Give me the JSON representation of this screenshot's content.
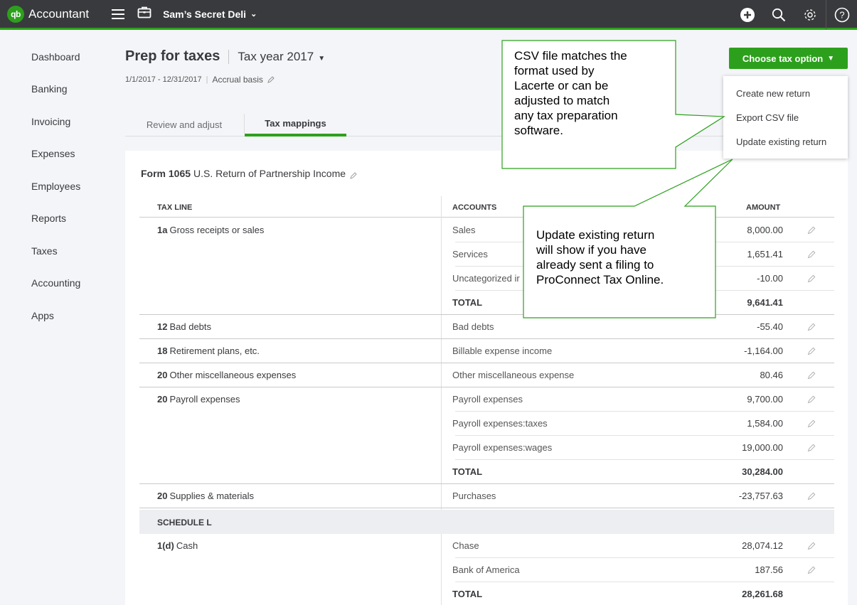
{
  "topbar": {
    "logo_badge": "qb",
    "app_name": "Accountant",
    "company_name": "Sam’s Secret Deli",
    "icons": [
      "menu-icon",
      "briefcase-icon",
      "add-icon",
      "search-icon",
      "gear-icon",
      "help-icon"
    ],
    "accent_color": "#2ca01c"
  },
  "sidebar": {
    "items": [
      {
        "label": "Dashboard"
      },
      {
        "label": "Banking"
      },
      {
        "label": "Invoicing"
      },
      {
        "label": "Expenses"
      },
      {
        "label": "Employees"
      },
      {
        "label": "Reports"
      },
      {
        "label": "Taxes"
      },
      {
        "label": "Accounting"
      },
      {
        "label": "Apps"
      }
    ]
  },
  "header": {
    "title": "Prep for taxes",
    "tax_year": "Tax year 2017",
    "date_range": "1/1/2017 - 12/31/2017",
    "basis": "Accrual basis"
  },
  "tabs": {
    "review": "Review and adjust",
    "mappings": "Tax mappings"
  },
  "choose_tax": {
    "button_label": "Choose tax option",
    "options": [
      "Create new return",
      "Export CSV file",
      "Update existing return"
    ]
  },
  "form": {
    "code": "Form 1065",
    "name": "U.S. Return of Partnership Income"
  },
  "table": {
    "headers": {
      "tax_line": "TAX LINE",
      "accounts": "ACCOUNTS",
      "amount": "AMOUNT"
    },
    "rows": [
      {
        "line_num": "1a",
        "line_desc": "Gross receipts or sales",
        "account": "Sales",
        "amount": "8,000.00"
      },
      {
        "line_num": "",
        "line_desc": "",
        "account": "Services",
        "amount": "1,651.41"
      },
      {
        "line_num": "",
        "line_desc": "",
        "account": "Uncategorized ir",
        "amount": "-10.00"
      },
      {
        "line_num": "",
        "line_desc": "",
        "account": "TOTAL",
        "amount": "9,641.41"
      },
      {
        "line_num": "12",
        "line_desc": "Bad debts",
        "account": "Bad debts",
        "amount": "-55.40"
      },
      {
        "line_num": "18",
        "line_desc": "Retirement plans, etc.",
        "account": "Billable expense income",
        "amount": "-1,164.00"
      },
      {
        "line_num": "20",
        "line_desc": "Other miscellaneous expenses",
        "account": "Other miscellaneous expense",
        "amount": "80.46"
      },
      {
        "line_num": "20",
        "line_desc": "Payroll expenses",
        "account": "Payroll expenses",
        "amount": "9,700.00"
      },
      {
        "line_num": "",
        "line_desc": "",
        "account": "Payroll expenses:taxes",
        "amount": "1,584.00"
      },
      {
        "line_num": "",
        "line_desc": "",
        "account": "Payroll expenses:wages",
        "amount": "19,000.00"
      },
      {
        "line_num": "",
        "line_desc": "",
        "account": "TOTAL",
        "amount": "30,284.00"
      },
      {
        "line_num": "20",
        "line_desc": "Supplies & materials",
        "account": "Purchases",
        "amount": "-23,757.63"
      }
    ],
    "schedule_label": "SCHEDULE L",
    "schedule_rows": [
      {
        "line_num": "1(d)",
        "line_desc": "Cash",
        "account": "Chase",
        "amount": "28,074.12"
      },
      {
        "line_num": "",
        "line_desc": "",
        "account": "Bank of America",
        "amount": "187.56"
      },
      {
        "line_num": "",
        "line_desc": "",
        "account": "TOTAL",
        "amount": "28,261.68"
      }
    ]
  },
  "callouts": {
    "csv": [
      "CSV file matches the",
      "format used by",
      "Lacerte or can be",
      "adjusted to match",
      "any tax preparation",
      "software."
    ],
    "update": [
      "Update existing return",
      "will show if you have",
      "already sent a filing to",
      "ProConnect Tax Online."
    ]
  }
}
